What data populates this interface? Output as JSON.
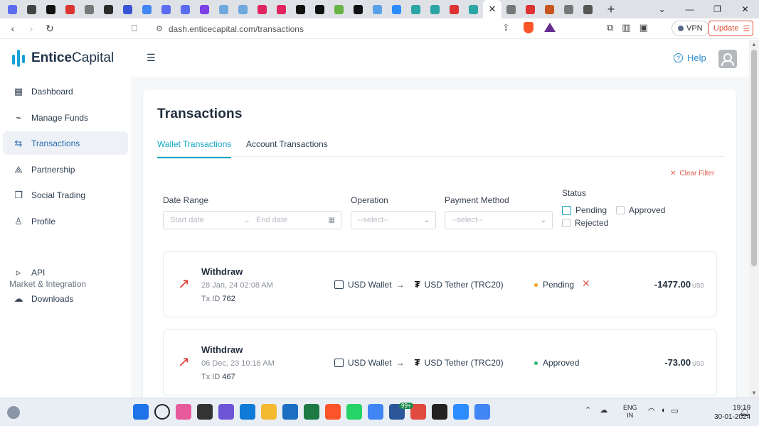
{
  "browser": {
    "url": "dash.enticecapital.com/transactions",
    "vpn_label": "VPN",
    "update_label": "Update",
    "tab_colors": [
      "#5b6cf0",
      "#444",
      "#111",
      "#d33",
      "#777",
      "#2b2b2b",
      "#3a54d6",
      "#4285f4",
      "#5b6cf0",
      "#5b6cf0",
      "#7b3fe4",
      "#6fa8dc",
      "#6fa8dc",
      "#e0245e",
      "#e0245e",
      "#111",
      "#111",
      "#67b346",
      "#111",
      "#5aa0e8",
      "#2d8cff",
      "#2ca5a5",
      "#2ca5a5",
      "#d33",
      "#2ca5a5",
      "#fff",
      "#777",
      "#d33",
      "#c8551d",
      "#777",
      "#555"
    ]
  },
  "brand": {
    "name_bold": "Entice",
    "name_rest": "Capital"
  },
  "header": {
    "help_label": "Help"
  },
  "sidebar": {
    "items": [
      {
        "label": "Dashboard",
        "icon": "dashboard-icon",
        "glyph": "▦"
      },
      {
        "label": "Manage Funds",
        "icon": "chart-icon",
        "glyph": "⌁"
      },
      {
        "label": "Transactions",
        "icon": "transfer-icon",
        "glyph": "⇆"
      },
      {
        "label": "Partnership",
        "icon": "network-icon",
        "glyph": "⟁"
      },
      {
        "label": "Social Trading",
        "icon": "copy-icon",
        "glyph": "❐"
      },
      {
        "label": "Profile",
        "icon": "user-icon",
        "glyph": "♙"
      }
    ],
    "section_title": "Market & Integration",
    "section_items": [
      {
        "label": "API",
        "icon": "terminal-icon",
        "glyph": "▹"
      },
      {
        "label": "Downloads",
        "icon": "cloud-download-icon",
        "glyph": "☁"
      }
    ]
  },
  "page": {
    "title": "Transactions",
    "tabs": [
      "Wallet Transactions",
      "Account Transactions"
    ],
    "clear_filter": "Clear Filter",
    "filters": {
      "date_range_label": "Date Range",
      "start_placeholder": "Start date",
      "end_placeholder": "End date",
      "operation_label": "Operation",
      "operation_placeholder": "--select--",
      "payment_label": "Payment Method",
      "payment_placeholder": "--select--",
      "status_label": "Status",
      "status_options": [
        "Pending",
        "Approved",
        "Rejected"
      ]
    }
  },
  "transactions": [
    {
      "type": "Withdraw",
      "date": "28 Jan, 24 02:08 AM",
      "txid_label": "Tx ID",
      "txid": "762",
      "from": "USD Wallet",
      "to": "USD Tether (TRC20)",
      "status": "Pending",
      "status_color": "#f0a020",
      "amount": "-1477.00",
      "currency": "USD"
    },
    {
      "type": "Withdraw",
      "date": "06 Dec, 23 10:16 AM",
      "txid_label": "Tx ID",
      "txid": "467",
      "from": "USD Wallet",
      "to": "USD Tether (TRC20)",
      "status": "Approved",
      "status_color": "#2eb872",
      "amount": "-73.00",
      "currency": "USD"
    }
  ],
  "taskbar": {
    "badge": "99+",
    "lang_line1": "ENG",
    "lang_line2": "IN",
    "time": "19:19",
    "date": "30-01-2024",
    "app_colors": [
      "#1e73e8",
      "#222",
      "#e75a9c",
      "#333",
      "#6e54d6",
      "#0f7bd6",
      "#f3b931",
      "#1b6ec2",
      "#1d7a43",
      "#fb542b",
      "#25d366",
      "#4285f4",
      "#2b579a",
      "#e04a3f",
      "#222",
      "#2d8cff",
      "#4285f4"
    ]
  }
}
